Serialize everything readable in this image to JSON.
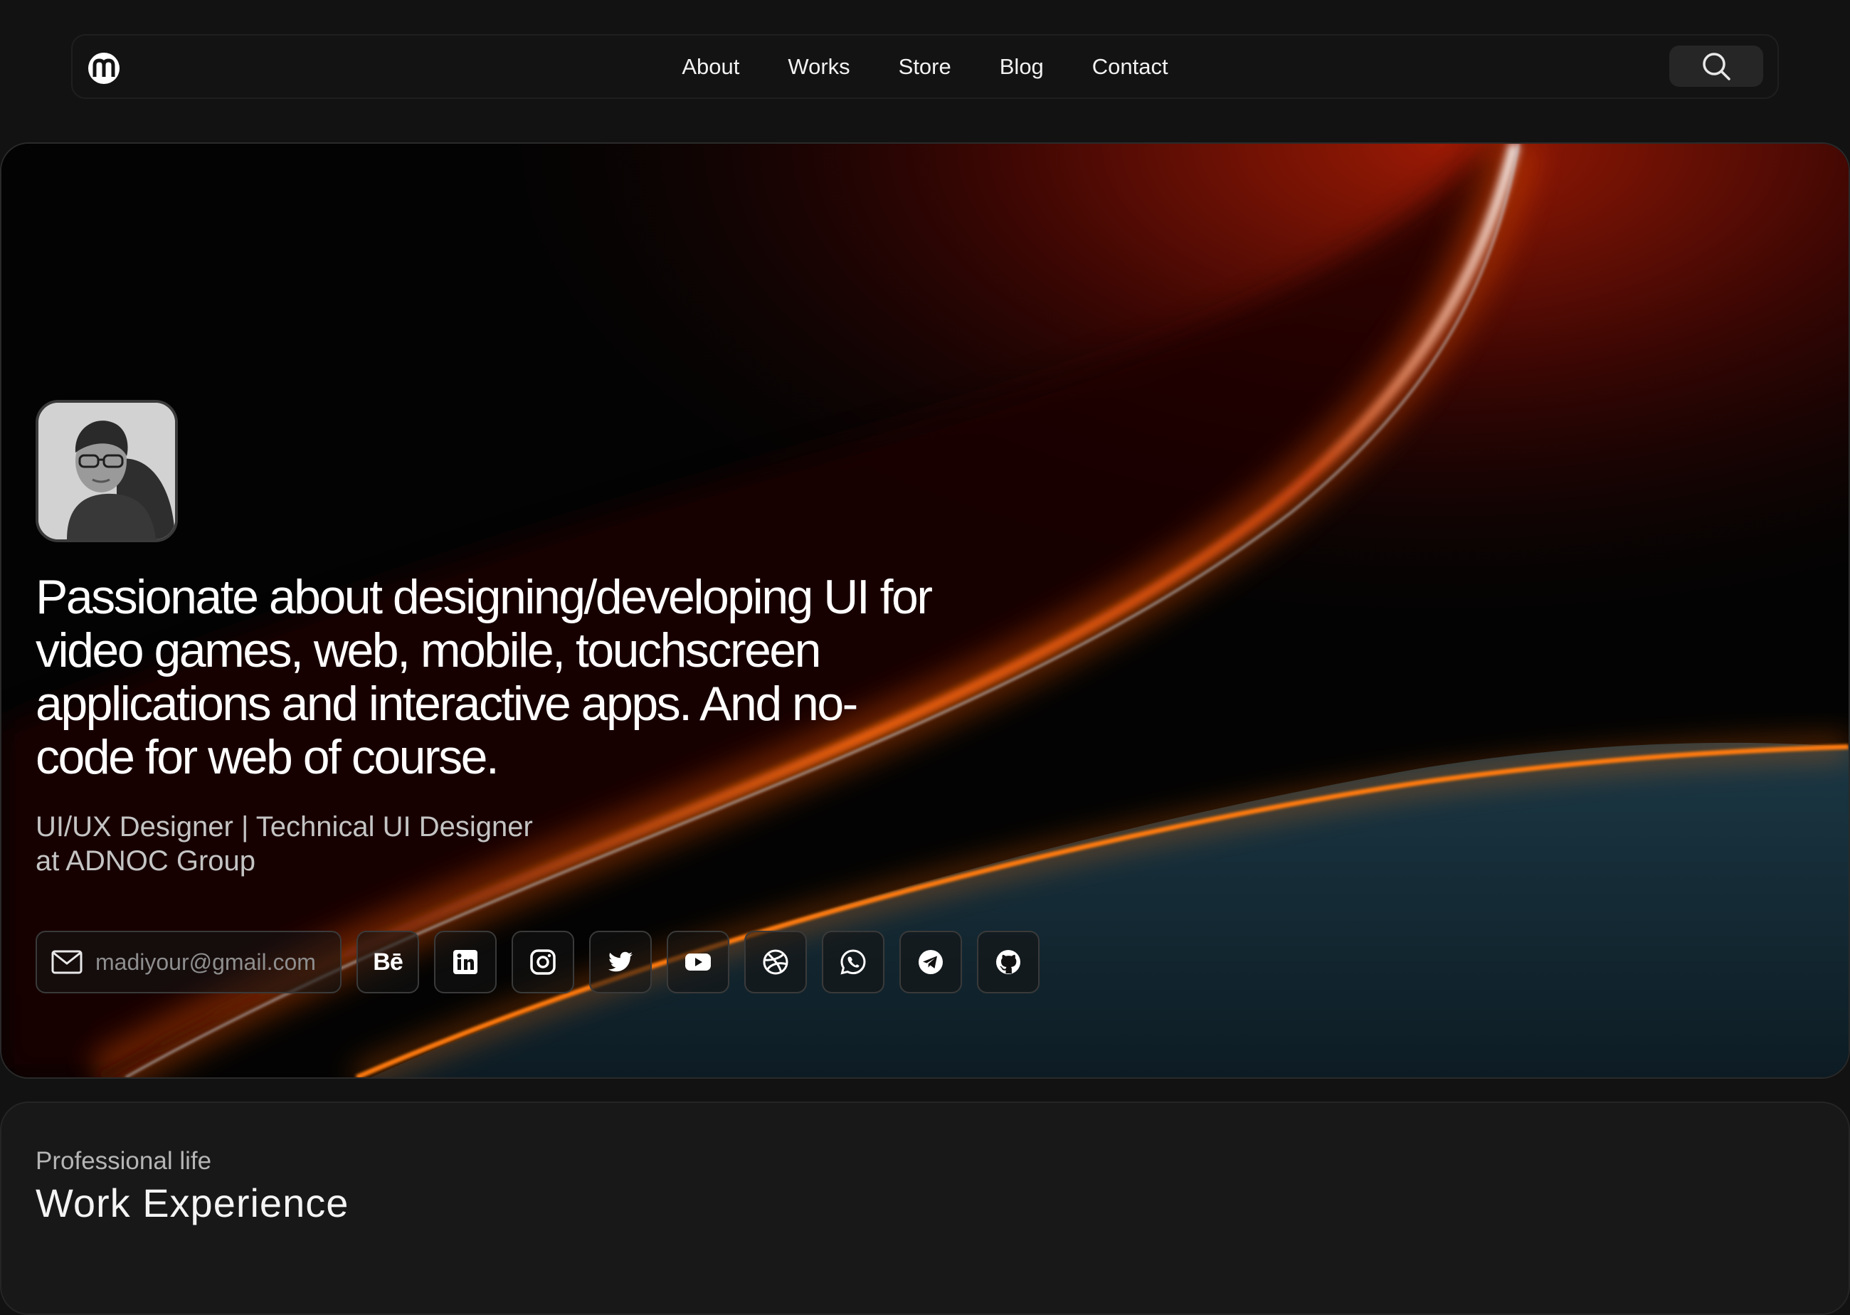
{
  "nav": {
    "links": [
      "About",
      "Works",
      "Store",
      "Blog",
      "Contact"
    ],
    "logo_icon": "logo-m-icon",
    "search_icon": "search-icon"
  },
  "hero": {
    "headline": "Passionate about designing/developing UI for video games, web, mobile, touchscreen applications and interactive apps. And no-code for web of course.",
    "subtitle": "UI/UX Designer | Technical UI Designer at ADNOC Group",
    "email": "madiyour@gmail.com",
    "behance_label": "Bē",
    "socials": [
      "behance-icon",
      "linkedin-icon",
      "instagram-icon",
      "twitter-icon",
      "youtube-icon",
      "dribbble-icon",
      "whatsapp-icon",
      "telegram-icon",
      "github-icon"
    ],
    "colors": {
      "accent_orange": "#ff5a00",
      "accent_teal": "#1c3a48"
    }
  },
  "work": {
    "overline": "Professional life",
    "title": "Work Experience"
  }
}
